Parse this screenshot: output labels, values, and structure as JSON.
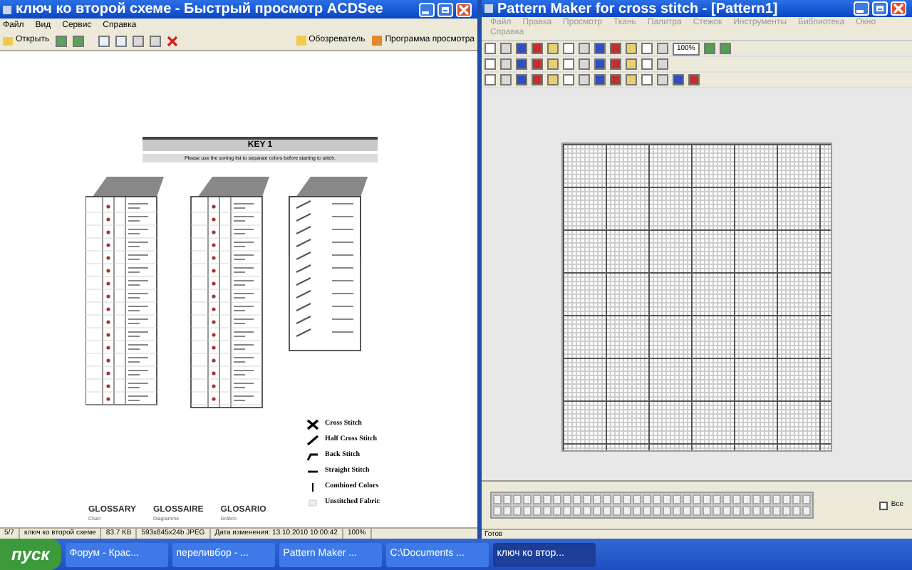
{
  "viewer": {
    "title": "ключ ко второй схеме - Быстрый просмотр ACDSee",
    "menu": [
      "Файл",
      "Вид",
      "Сервис",
      "Справка"
    ],
    "toolbar": {
      "open": "Открыть",
      "browser": "Обозреватель",
      "program": "Программа просмотра"
    },
    "key": {
      "title": "KEY 1",
      "note": "Please use the sorting list to separate colors before starting to stitch.",
      "legend": [
        {
          "kind": "cross",
          "label": "Cross Stitch"
        },
        {
          "kind": "half",
          "label": "Half Cross Stitch"
        },
        {
          "kind": "back",
          "label": "Back Stitch"
        },
        {
          "kind": "straight",
          "label": "Straight Stitch"
        },
        {
          "kind": "combined",
          "label": "Combined Colors"
        },
        {
          "kind": "unstitched",
          "label": "Unstitched Fabric"
        }
      ],
      "glossary": [
        {
          "word": "GLOSSARY",
          "meaning": "Chart"
        },
        {
          "word": "GLOSSAIRE",
          "meaning": "Diagramme"
        },
        {
          "word": "GLOSARIO",
          "meaning": "Gráfico"
        }
      ]
    },
    "status": [
      "5/7",
      "ключ ко второй схеме",
      "83.7 KB",
      "593x845x24b JPEG",
      "Дата изменения: 13.10.2010 10:00:42",
      "100%"
    ]
  },
  "editor": {
    "title": "Pattern Maker for cross stitch - [Pattern1]",
    "menu": [
      "Файл",
      "Правка",
      "Просмотр",
      "Ткань",
      "Палитра",
      "Стежок",
      "Инструменты",
      "Библиотека",
      "Окно",
      "Справка"
    ],
    "zoom": "100%",
    "all_label": "Все",
    "all_checked": false,
    "status": "Готов"
  },
  "taskbar": {
    "start": "пуск",
    "tasks": [
      {
        "label": "Форум - Крас...",
        "selected": false
      },
      {
        "label": "переливбор - ...",
        "selected": false
      },
      {
        "label": "Pattern Maker ...",
        "selected": false
      },
      {
        "label": "C:\\Documents ...",
        "selected": false
      },
      {
        "label": "ключ ко втор...",
        "selected": true
      }
    ]
  }
}
